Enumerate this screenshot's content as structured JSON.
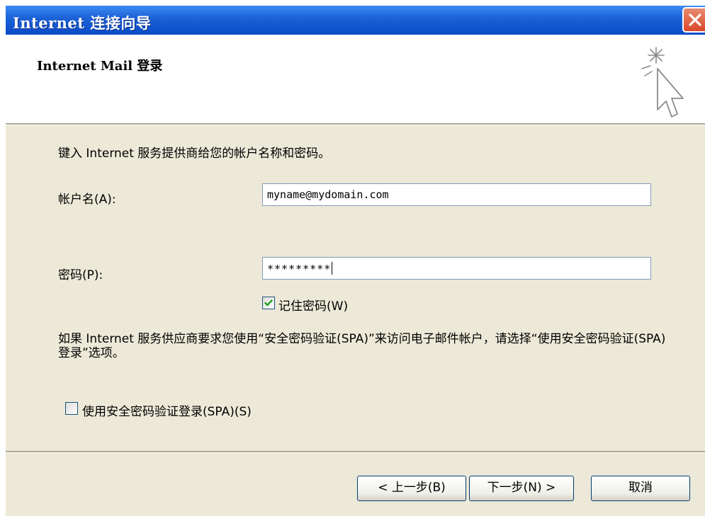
{
  "window": {
    "title": "Internet 连接向导"
  },
  "header": {
    "heading": "Internet Mail 登录"
  },
  "form": {
    "intro": "键入 Internet 服务提供商给您的帐户名称和密码。",
    "account_label": "帐户名(A):",
    "account_value": "myname@mydomain.com",
    "password_label": "密码(P):",
    "password_value": "*********",
    "remember_label": "记住密码(W)",
    "remember_checked": true,
    "spa_info": "如果 Internet 服务供应商要求您使用“安全密码验证(SPA)”来访问电子邮件帐户，请选择“使用安全密码验证(SPA)登录”选项。",
    "spa_label": "使用安全密码验证登录(SPA)(S)",
    "spa_checked": false
  },
  "buttons": {
    "back": "< 上一步(B)",
    "next": "下一步(N) >",
    "cancel": "取消"
  },
  "colors": {
    "titlebar": "#0a4bc8",
    "dialog_bg": "#ece9d8",
    "close_button": "#d9472a",
    "check_mark": "#21a121"
  }
}
